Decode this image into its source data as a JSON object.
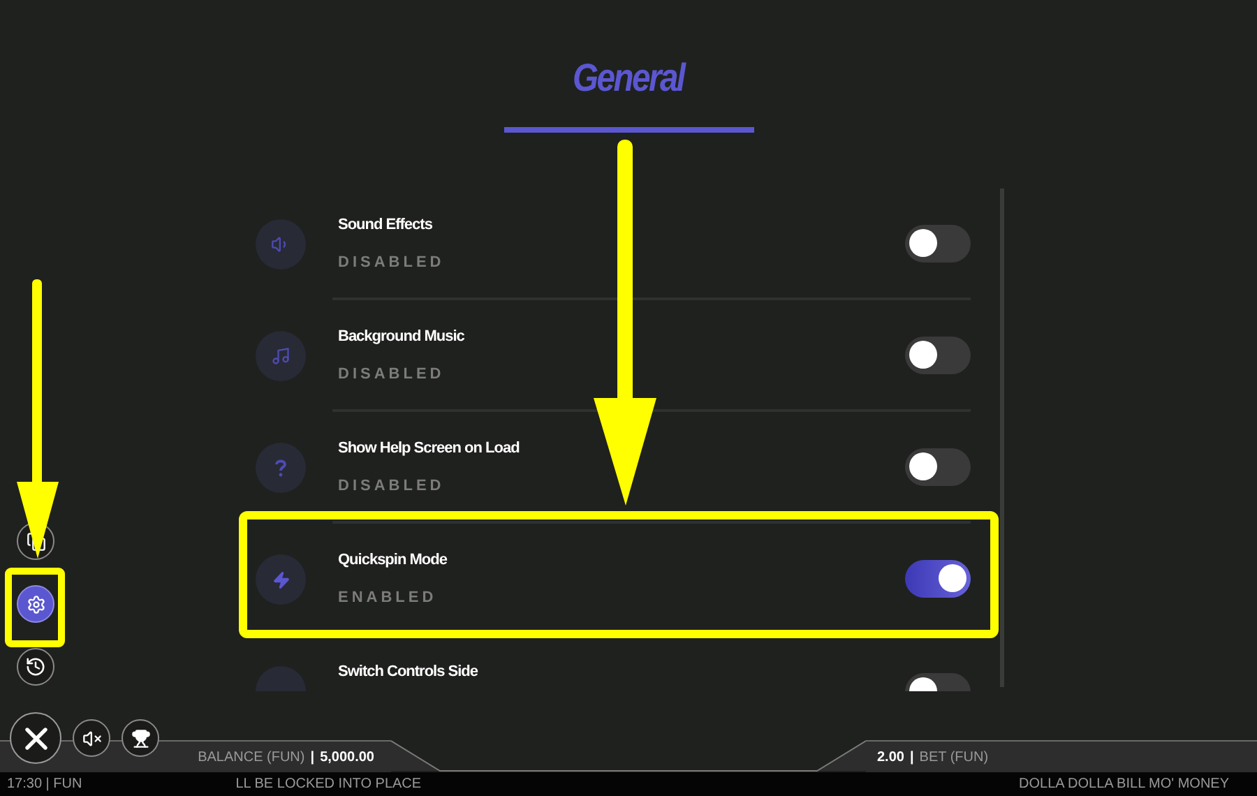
{
  "title": "General",
  "settings": [
    {
      "label": "Sound Effects",
      "status": "DISABLED",
      "on": false
    },
    {
      "label": "Background Music",
      "status": "DISABLED",
      "on": false
    },
    {
      "label": "Show Help Screen on Load",
      "status": "DISABLED",
      "on": false
    },
    {
      "label": "Quickspin Mode",
      "status": "ENABLED",
      "on": true
    },
    {
      "label": "Switch Controls Side",
      "on": false
    }
  ],
  "side_buttons": [
    {
      "selected": false
    },
    {
      "selected": true
    },
    {
      "selected": false
    }
  ],
  "balance": {
    "label": "BALANCE (FUN)",
    "separator": "|",
    "value": "5,000.00"
  },
  "bet": {
    "value": "2.00",
    "separator": "|",
    "label": "BET (FUN)"
  },
  "ticker": [
    "17:30 | FUN",
    "LL BE LOCKED INTO PLACE",
    "DOLLA DOLLA BILL MO' MONEY"
  ]
}
